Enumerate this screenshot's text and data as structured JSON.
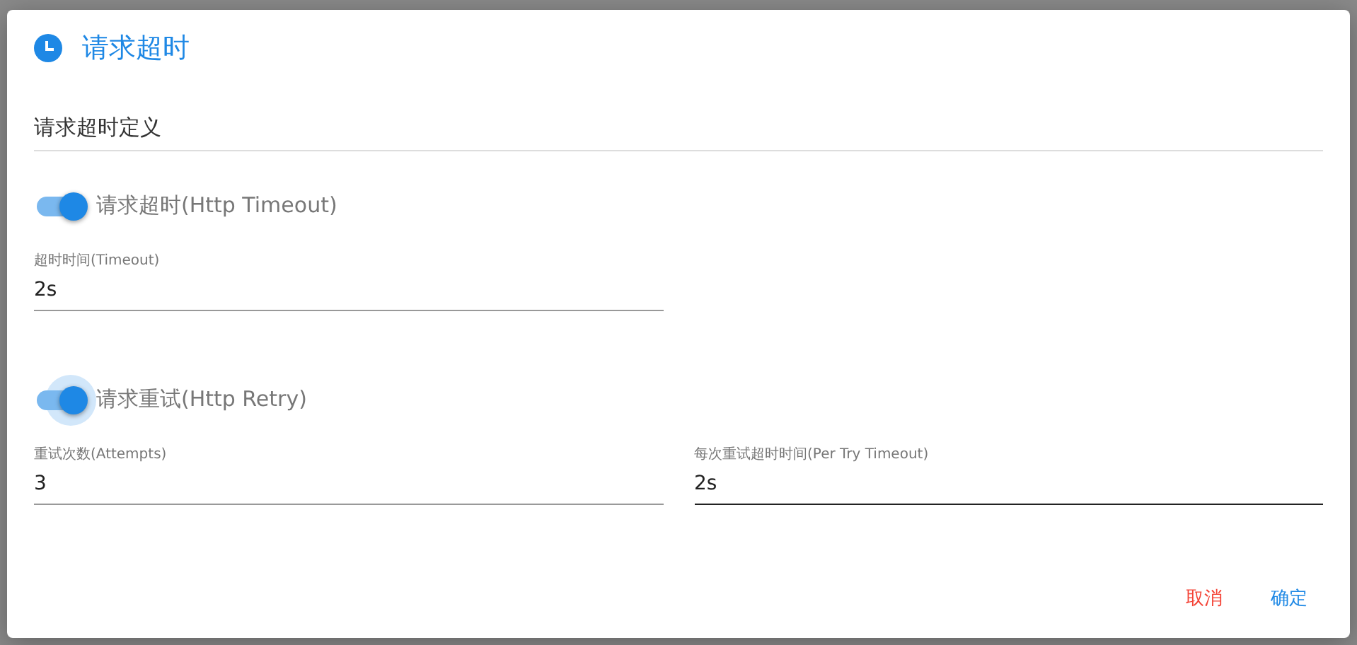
{
  "dialog": {
    "title": "请求超时",
    "section_title": "请求超时定义",
    "groups": [
      {
        "toggle": {
          "label": "请求超时(Http Timeout)",
          "on": true,
          "focused": false
        },
        "fields": [
          {
            "label": "超时时间(Timeout)",
            "value": "2s",
            "hovered": false
          }
        ]
      },
      {
        "toggle": {
          "label": "请求重试(Http Retry)",
          "on": true,
          "focused": true
        },
        "fields": [
          {
            "label": "重试次数(Attempts)",
            "value": "3",
            "hovered": false
          },
          {
            "label": "每次重试超时时间(Per Try Timeout)",
            "value": "2s",
            "hovered": true
          }
        ]
      }
    ],
    "buttons": [
      {
        "label": "取消",
        "kind": "cancel"
      },
      {
        "label": "确定",
        "kind": "confirm"
      }
    ]
  }
}
